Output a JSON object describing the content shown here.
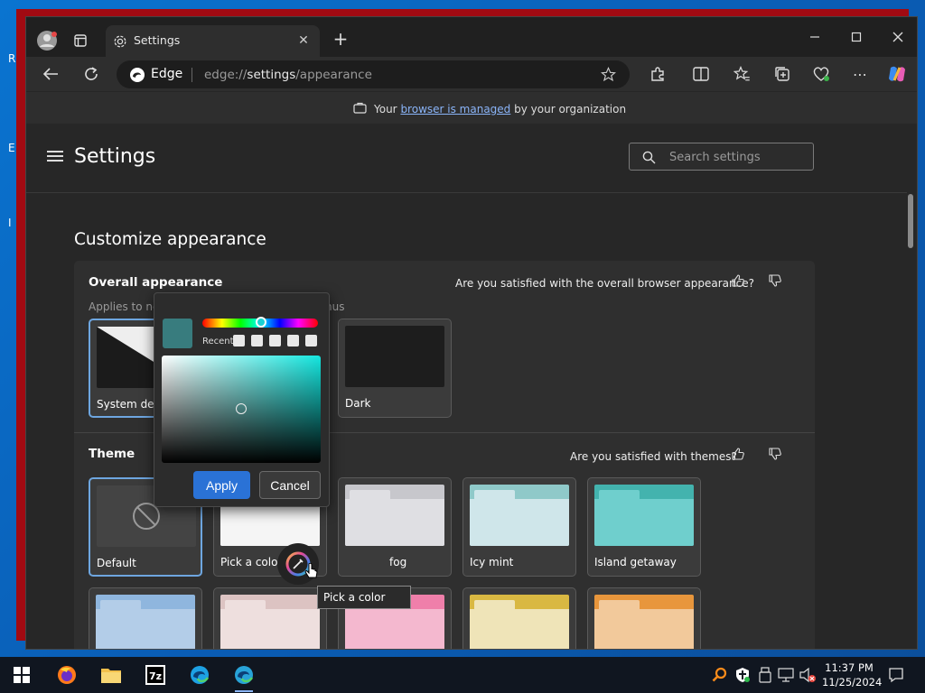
{
  "desktop": {
    "letters": [
      "R",
      "E",
      "I"
    ]
  },
  "browser": {
    "tab": {
      "title": "Settings"
    },
    "address": {
      "brand": "Edge",
      "url_scheme": "edge://",
      "url_host": "settings",
      "url_path": "/appearance"
    },
    "infobar": {
      "prefix": "Your ",
      "link": "browser is managed",
      "suffix": " by your organization"
    }
  },
  "settings": {
    "title": "Settings",
    "search_placeholder": "Search settings",
    "page_heading": "Customize appearance",
    "overall": {
      "title": "Overall appearance",
      "subtitle_visible": "Applies to ne",
      "subtitle_end": "nus",
      "feedback": "Are you satisfied with the overall browser appearance?",
      "cards": [
        {
          "label": "System defa"
        },
        {
          "label": "Dark"
        }
      ]
    },
    "theme": {
      "title": "Theme",
      "feedback": "Are you satisfied with themes?",
      "cards": [
        {
          "label": "Default"
        },
        {
          "label": "Pick a color"
        },
        {
          "label": "fog"
        },
        {
          "label": "Icy mint"
        },
        {
          "label": "Island getaway"
        }
      ]
    },
    "colors": {
      "accent": "#6ea6e0",
      "theme_bg": [
        "#3a3a3a",
        "#eaeaea",
        "#dcdce0",
        "#cfe6ea",
        "#6fcfcd"
      ],
      "row2_bg": [
        "#b3cde8",
        "#eedfde",
        "#f4b8cf",
        "#efe4b8",
        "#f2c99b"
      ]
    }
  },
  "color_picker": {
    "recent_label": "Recent",
    "apply": "Apply",
    "cancel": "Cancel",
    "current_color": "#387c7e"
  },
  "tooltip": "Pick a color",
  "tray": {
    "time": "11:37 PM",
    "date": "11/25/2024"
  }
}
